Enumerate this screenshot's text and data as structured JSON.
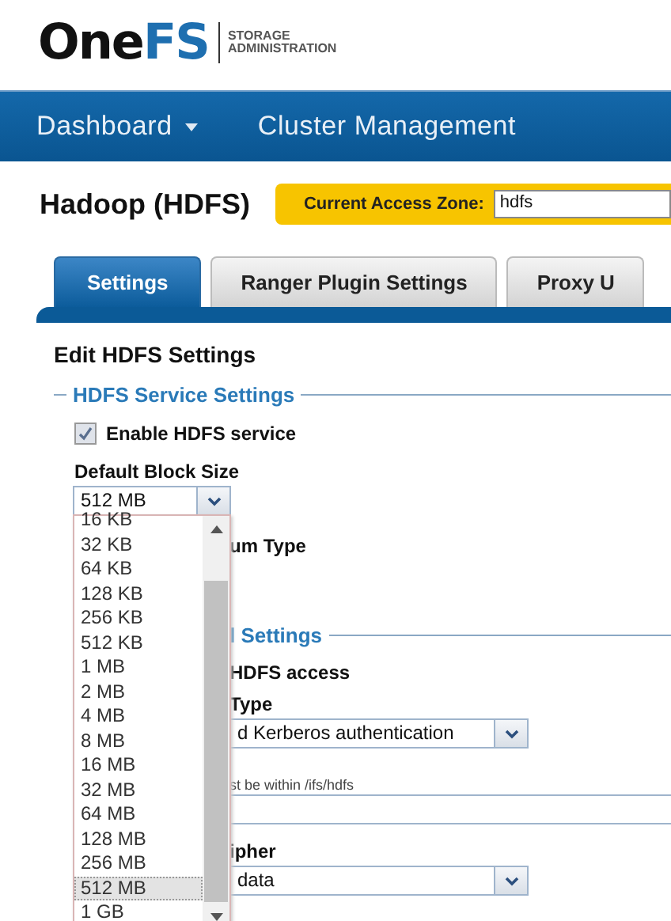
{
  "header": {
    "logo": [
      "One",
      "FS"
    ],
    "subtitle": [
      "STORAGE",
      "ADMINISTRATION"
    ]
  },
  "nav": [
    {
      "label": "Dashboard",
      "has_menu": true
    },
    {
      "label": "Cluster Management",
      "has_menu": false
    }
  ],
  "page": {
    "title": "Hadoop (HDFS)",
    "zone_label": "Current Access Zone:",
    "zone_value": "hdfs"
  },
  "tabs": [
    {
      "label": "Settings",
      "selected": true
    },
    {
      "label": "Ranger Plugin Settings",
      "selected": false
    },
    {
      "label": "Proxy U",
      "selected": false
    }
  ],
  "form": {
    "heading": "Edit HDFS Settings",
    "legend": "HDFS Service Settings",
    "enable": {
      "label": "Enable HDFS service",
      "checked": true
    },
    "block_size": {
      "label": "Default Block Size",
      "value": "512 MB"
    },
    "hidden": [
      {
        "kind": "label",
        "text": "um Type"
      },
      {
        "kind": "legend",
        "text": "l Settings"
      },
      {
        "kind": "check",
        "text": "HDFS access"
      },
      {
        "kind": "label",
        "text": "Type"
      },
      {
        "kind": "select",
        "text": "d Kerberos authentication"
      },
      {
        "kind": "hint",
        "text": "st be within /ifs/hdfs"
      },
      {
        "kind": "input"
      },
      {
        "kind": "label",
        "text": "ipher"
      },
      {
        "kind": "select",
        "text": "data"
      }
    ]
  },
  "dropdown": {
    "options": [
      {
        "label": "16 KB",
        "selected": false
      },
      {
        "label": "32 KB",
        "selected": false
      },
      {
        "label": "64 KB",
        "selected": false
      },
      {
        "label": "128 KB",
        "selected": false
      },
      {
        "label": "256 KB",
        "selected": false
      },
      {
        "label": "512 KB",
        "selected": false
      },
      {
        "label": "1 MB",
        "selected": false
      },
      {
        "label": "2 MB",
        "selected": false
      },
      {
        "label": "4 MB",
        "selected": false
      },
      {
        "label": "8 MB",
        "selected": false
      },
      {
        "label": "16 MB",
        "selected": false
      },
      {
        "label": "32 MB",
        "selected": false
      },
      {
        "label": "64 MB",
        "selected": false
      },
      {
        "label": "128 MB",
        "selected": false
      },
      {
        "label": "256 MB",
        "selected": false
      },
      {
        "label": "512 MB",
        "selected": true
      },
      {
        "label": "1 GB",
        "selected": false
      }
    ]
  }
}
